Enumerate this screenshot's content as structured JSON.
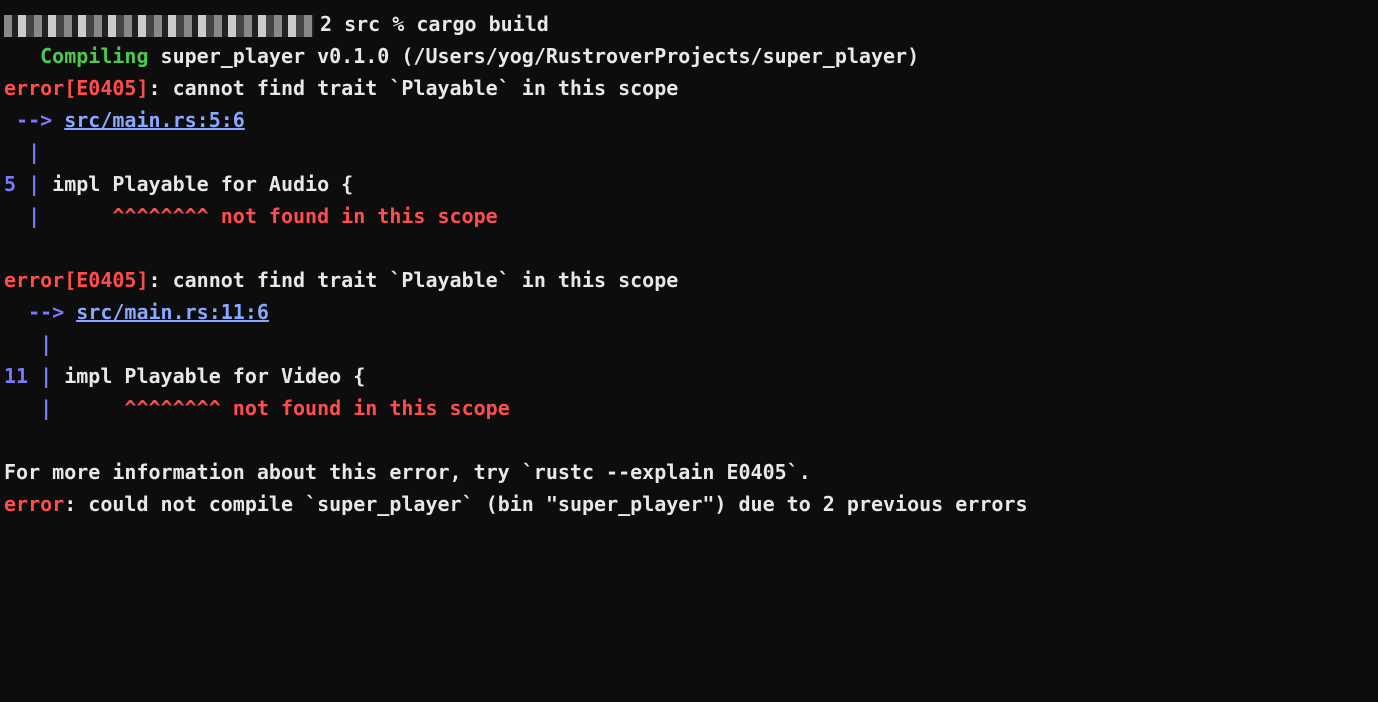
{
  "prompt": {
    "suffix": "2 src % cargo build"
  },
  "compiling": {
    "label": "Compiling",
    "text": " super_player v0.1.0 (/Users/yog/RustroverProjects/super_player)"
  },
  "error1": {
    "prefix": "error[E0405]",
    "message": ": cannot find trait `Playable` in this scope",
    "arrow": " --> ",
    "location": "src/main.rs:5:6",
    "pipe1": "  |",
    "line_num": "5 ",
    "pipe2": "|",
    "code": " impl Playable for Audio {",
    "pipe3": "  |",
    "carets": "      ^^^^^^^^",
    "not_found": " not found in this scope"
  },
  "error2": {
    "prefix": "error[E0405]",
    "message": ": cannot find trait `Playable` in this scope",
    "arrow": "  --> ",
    "location": "src/main.rs:11:6",
    "pipe1": "   |",
    "line_num": "11 ",
    "pipe2": "|",
    "code": " impl Playable for Video {",
    "pipe3": "   |",
    "carets": "      ^^^^^^^^",
    "not_found": " not found in this scope"
  },
  "footer": {
    "info": "For more information about this error, try `rustc --explain E0405`.",
    "error_label": "error",
    "final_msg": ": could not compile `super_player` (bin \"super_player\") due to 2 previous errors"
  }
}
